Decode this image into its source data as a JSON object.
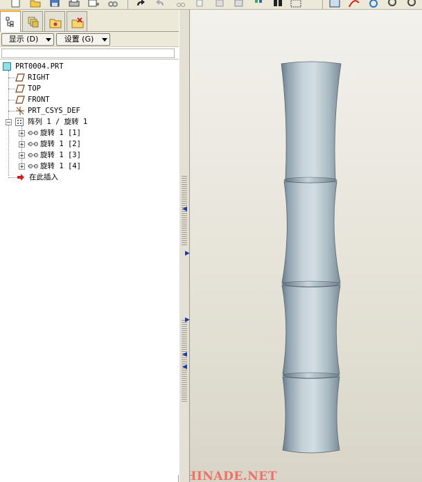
{
  "tabs": [
    {
      "id": "model-tree",
      "icon": "model-tree-icon",
      "active": true
    },
    {
      "id": "layers",
      "icon": "layers-icon",
      "active": false
    },
    {
      "id": "folder-browser",
      "icon": "folder-icon",
      "active": false
    },
    {
      "id": "favorites",
      "icon": "favorites-icon",
      "active": false
    }
  ],
  "menu": {
    "show_label": "显示 (D)",
    "settings_label": "设置 (G)"
  },
  "tree": {
    "root": "PRT0004.PRT",
    "datum_right": "RIGHT",
    "datum_top": "TOP",
    "datum_front": "FRONT",
    "csys": "PRT_CSYS_DEF",
    "pattern": "阵列 1 / 旋转 1",
    "children": [
      "旋转 1 [1]",
      "旋转 1 [2]",
      "旋转 1 [3]",
      "旋转 1 [4]"
    ],
    "insert_here": "在此插入"
  },
  "watermark": "BBS.CHINADE.NET",
  "colors": {
    "accent_tab": "#f5a623",
    "watermark": "#f07066",
    "insert_arrow": "#d81c1c",
    "model_shade_dark": "#6b7d8a",
    "model_shade_light": "#d2dde3"
  }
}
